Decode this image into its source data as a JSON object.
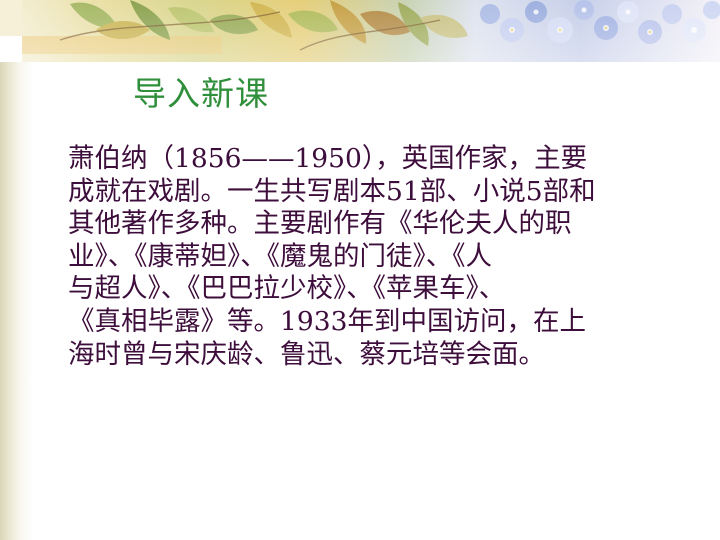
{
  "slide": {
    "title": "导入新课",
    "body_lines": [
      " 萧伯纳（1856——1950），英国作家，主要",
      "成就在戏剧。一生共写剧本51部、小说5部和",
      "其他著作多种。主要剧作有《华伦夫人的职",
      "业》、《康蒂妲》、《魔鬼的门徒》、《人",
      "与超人》、《巴巴拉少校》、《苹果车》、",
      " 《真相毕露》等。1933年到中国访问，在上",
      "海时曾与宋庆龄、鲁迅、蔡元培等会面。"
    ]
  },
  "colors": {
    "title": "#2f8f3a",
    "body_text": "#3d0d3b",
    "background": "#ffffff"
  }
}
